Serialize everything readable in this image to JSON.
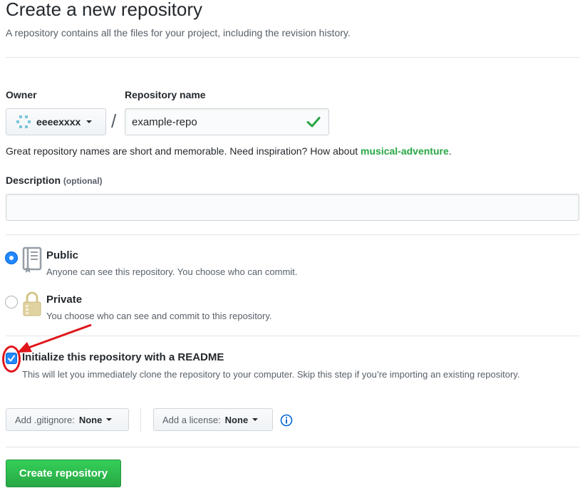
{
  "page": {
    "title": "Create a new repository",
    "subtitle": "A repository contains all the files for your project, including the revision history."
  },
  "owner": {
    "label": "Owner",
    "value": "eeeexxxx"
  },
  "repo_name": {
    "label": "Repository name",
    "separator": "/",
    "value": "example-repo",
    "status_icon": "check-icon"
  },
  "hint": {
    "text": "Great repository names are short and memorable. Need inspiration? How about ",
    "suggestion": "musical-adventure",
    "end": "."
  },
  "description": {
    "label": "Description",
    "optional_label": "(optional)",
    "value": ""
  },
  "visibility": {
    "public": {
      "title": "Public",
      "note": "Anyone can see this repository. You choose who can commit.",
      "checked": true,
      "icon": "repo-book-icon"
    },
    "private": {
      "title": "Private",
      "note": "You choose who can see and commit to this repository.",
      "checked": false,
      "icon": "lock-icon"
    }
  },
  "readme": {
    "label": "Initialize this repository with a README",
    "note": "This will let you immediately clone the repository to your computer. Skip this step if you’re importing an existing repository.",
    "checked": true
  },
  "gitignore": {
    "prefix": "Add .gitignore:",
    "value": "None"
  },
  "license": {
    "prefix": "Add a license:",
    "value": "None"
  },
  "submit": {
    "label": "Create repository"
  },
  "colors": {
    "accent_blue": "#2188ff",
    "success_green": "#28a745",
    "annotation_red": "#e0161b"
  }
}
